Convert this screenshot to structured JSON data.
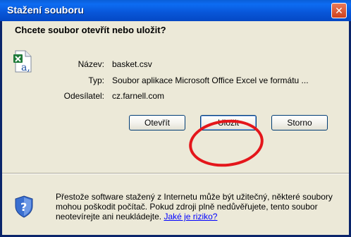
{
  "window": {
    "title": "Stažení souboru",
    "close_glyph": "✕"
  },
  "dialog": {
    "question": "Chcete soubor otevřít nebo uložit?",
    "fields": {
      "name_label": "Název:",
      "name_value": "basket.csv",
      "type_label": "Typ:",
      "type_value": "Soubor aplikace Microsoft Office Excel ve formátu ...",
      "sender_label": "Odesílatel:",
      "sender_value": "cz.farnell.com"
    },
    "buttons": {
      "open": "Otevřít",
      "save": "Uložit",
      "cancel": "Storno"
    },
    "warning": {
      "text": "Přestože software stažený z Internetu může být užitečný, některé soubory mohou poškodit počítač. Pokud zdroji plně nedůvěřujete, tento soubor neotevírejte ani neukládejte. ",
      "link": "Jaké je riziko?"
    }
  },
  "icons": {
    "file": "excel-csv-file-icon",
    "shield": "security-shield-icon",
    "close": "close-icon"
  },
  "colors": {
    "titlebar": "#0a5fd8",
    "dialog_bg": "#ece9d8",
    "highlight": "#e4161b",
    "link": "#0000ff"
  }
}
